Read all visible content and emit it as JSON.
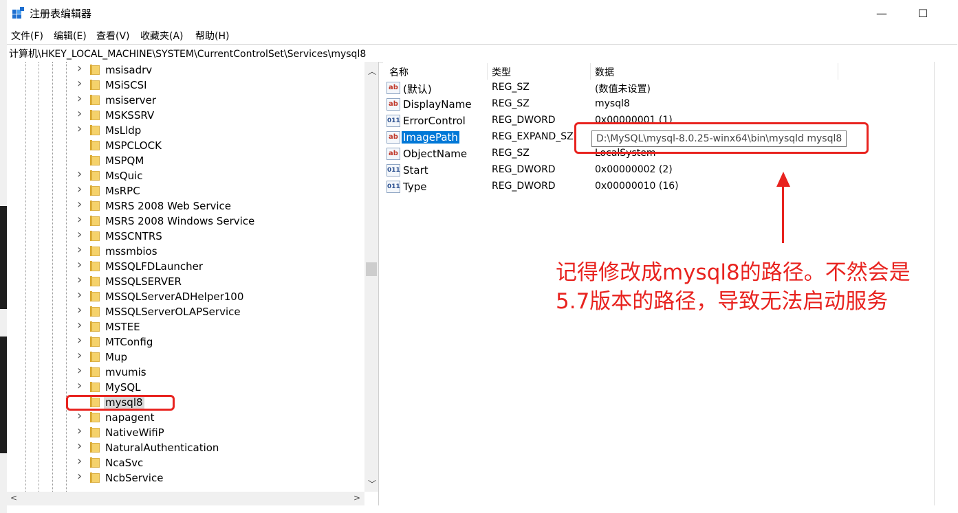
{
  "window": {
    "title": "注册表编辑器",
    "minimize_glyph": "—",
    "maximize_glyph": "☐"
  },
  "menu": [
    "文件(F)",
    "编辑(E)",
    "查看(V)",
    "收藏夹(A)",
    "帮助(H)"
  ],
  "address": "计算机\\HKEY_LOCAL_MACHINE\\SYSTEM\\CurrentControlSet\\Services\\mysql8",
  "tree": {
    "items": [
      {
        "label": "msisadrv",
        "expandable": true
      },
      {
        "label": "MSiSCSI",
        "expandable": true
      },
      {
        "label": "msiserver",
        "expandable": true
      },
      {
        "label": "MSKSSRV",
        "expandable": true
      },
      {
        "label": "MsLldp",
        "expandable": true
      },
      {
        "label": "MSPCLOCK",
        "expandable": false
      },
      {
        "label": "MSPQM",
        "expandable": false
      },
      {
        "label": "MsQuic",
        "expandable": true
      },
      {
        "label": "MsRPC",
        "expandable": true
      },
      {
        "label": "MSRS 2008 Web Service",
        "expandable": true
      },
      {
        "label": "MSRS 2008 Windows Service",
        "expandable": true
      },
      {
        "label": "MSSCNTRS",
        "expandable": true
      },
      {
        "label": "mssmbios",
        "expandable": true
      },
      {
        "label": "MSSQLFDLauncher",
        "expandable": true
      },
      {
        "label": "MSSQLSERVER",
        "expandable": true
      },
      {
        "label": "MSSQLServerADHelper100",
        "expandable": true
      },
      {
        "label": "MSSQLServerOLAPService",
        "expandable": true
      },
      {
        "label": "MSTEE",
        "expandable": true
      },
      {
        "label": "MTConfig",
        "expandable": true
      },
      {
        "label": "Mup",
        "expandable": true
      },
      {
        "label": "mvumis",
        "expandable": true
      },
      {
        "label": "MySQL",
        "expandable": true
      },
      {
        "label": "mysql8",
        "expandable": false,
        "selected": true
      },
      {
        "label": "napagent",
        "expandable": true
      },
      {
        "label": "NativeWifiP",
        "expandable": true
      },
      {
        "label": "NaturalAuthentication",
        "expandable": true
      },
      {
        "label": "NcaSvc",
        "expandable": true
      },
      {
        "label": "NcbService",
        "expandable": true
      }
    ]
  },
  "list": {
    "headers": {
      "name": "名称",
      "type": "类型",
      "data": "数据"
    },
    "rows": [
      {
        "icon": "ab",
        "name": "(默认)",
        "type": "REG_SZ",
        "data": "(数值未设置)"
      },
      {
        "icon": "ab",
        "name": "DisplayName",
        "type": "REG_SZ",
        "data": "mysql8"
      },
      {
        "icon": "bin",
        "name": "ErrorControl",
        "type": "REG_DWORD",
        "data": "0x00000001 (1)"
      },
      {
        "icon": "ab",
        "name": "ImagePath",
        "type": "REG_EXPAND_SZ",
        "data": "",
        "selected": true
      },
      {
        "icon": "ab",
        "name": "ObjectName",
        "type": "REG_SZ",
        "data": "LocalSystem"
      },
      {
        "icon": "bin",
        "name": "Start",
        "type": "REG_DWORD",
        "data": "0x00000002 (2)"
      },
      {
        "icon": "bin",
        "name": "Type",
        "type": "REG_DWORD",
        "data": "0x00000010 (16)"
      }
    ]
  },
  "tooltip": "D:\\MySQL\\mysql-8.0.25-winx64\\bin\\mysqld mysql8",
  "annotation": "记得修改成mysql8的路径。不然会是5.7版本的路径，导致无法启动服务",
  "colors": {
    "accent": "#0078d7",
    "annotation_red": "#e8231f"
  }
}
